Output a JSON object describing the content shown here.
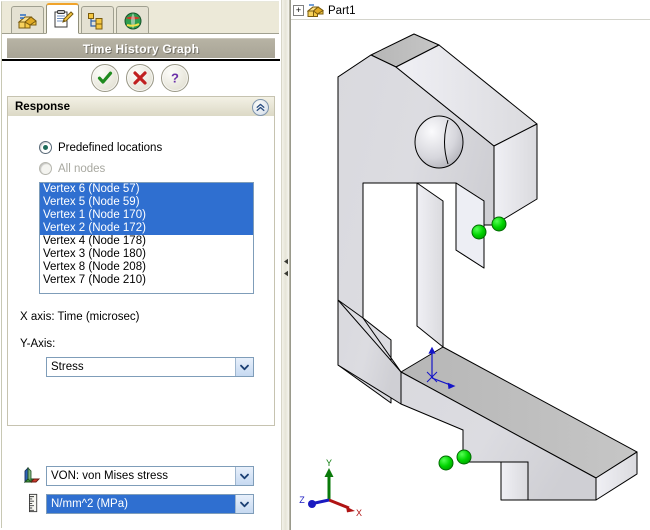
{
  "window": {
    "title": "Time History Graph"
  },
  "tabs": [
    {
      "name": "feature-manager-tab",
      "icon": "part-feature-tree-icon",
      "active": false
    },
    {
      "name": "property-manager-tab",
      "icon": "clipboard-pencil-icon",
      "active": true
    },
    {
      "name": "configuration-manager-tab",
      "icon": "configuration-tree-icon",
      "active": false
    },
    {
      "name": "display-manager-tab",
      "icon": "globe-render-icon",
      "active": false
    }
  ],
  "actions": {
    "ok_label": "OK",
    "cancel_label": "Cancel",
    "help_label": "Help"
  },
  "response": {
    "header": "Response",
    "collapse_icon": "double-chevron-up-icon",
    "predefined_label": "Predefined locations",
    "predefined_selected": true,
    "all_nodes_label": "All nodes",
    "all_nodes_disabled": true,
    "nodes": [
      {
        "label": "Vertex 6 (Node 57)",
        "selected": true
      },
      {
        "label": "Vertex 5 (Node 59)",
        "selected": true
      },
      {
        "label": "Vertex 1 (Node 170)",
        "selected": true
      },
      {
        "label": "Vertex 2 (Node 172)",
        "selected": true
      },
      {
        "label": "Vertex 4 (Node 178)",
        "selected": false
      },
      {
        "label": "Vertex 3 (Node 180)",
        "selected": false
      },
      {
        "label": "Vertex 8 (Node 208)",
        "selected": false
      },
      {
        "label": "Vertex 7 (Node 210)",
        "selected": false
      }
    ],
    "x_axis_label": "X axis:  Time (microsec)",
    "y_axis_label": "Y-Axis:",
    "y_axis_type": "Stress",
    "quantity": "VON: von Mises stress",
    "quantity_icon": "stress-plot-icon",
    "units": "N/mm^2 (MPa)",
    "units_icon": "ruler-icon",
    "dropdown_icon": "chevron-down-icon"
  },
  "viewport": {
    "tree_expander": "+",
    "tree_label": "Part1",
    "tree_icon": "part-icon",
    "triad": {
      "x": "X",
      "y": "Y",
      "z": "Z"
    },
    "vertex_marker_color": "#00cc00",
    "origin_color": "#0000cc",
    "face_light": "#e8e8ee",
    "face_mid": "#d2d2d6",
    "face_dark": "#b4b4b4",
    "edge_color": "#000000"
  },
  "colors": {
    "accent": "#f0a32a",
    "selection": "#2f6fd0",
    "title_bar": "#b0ac9e",
    "panel_bg": "#ece9d8"
  }
}
